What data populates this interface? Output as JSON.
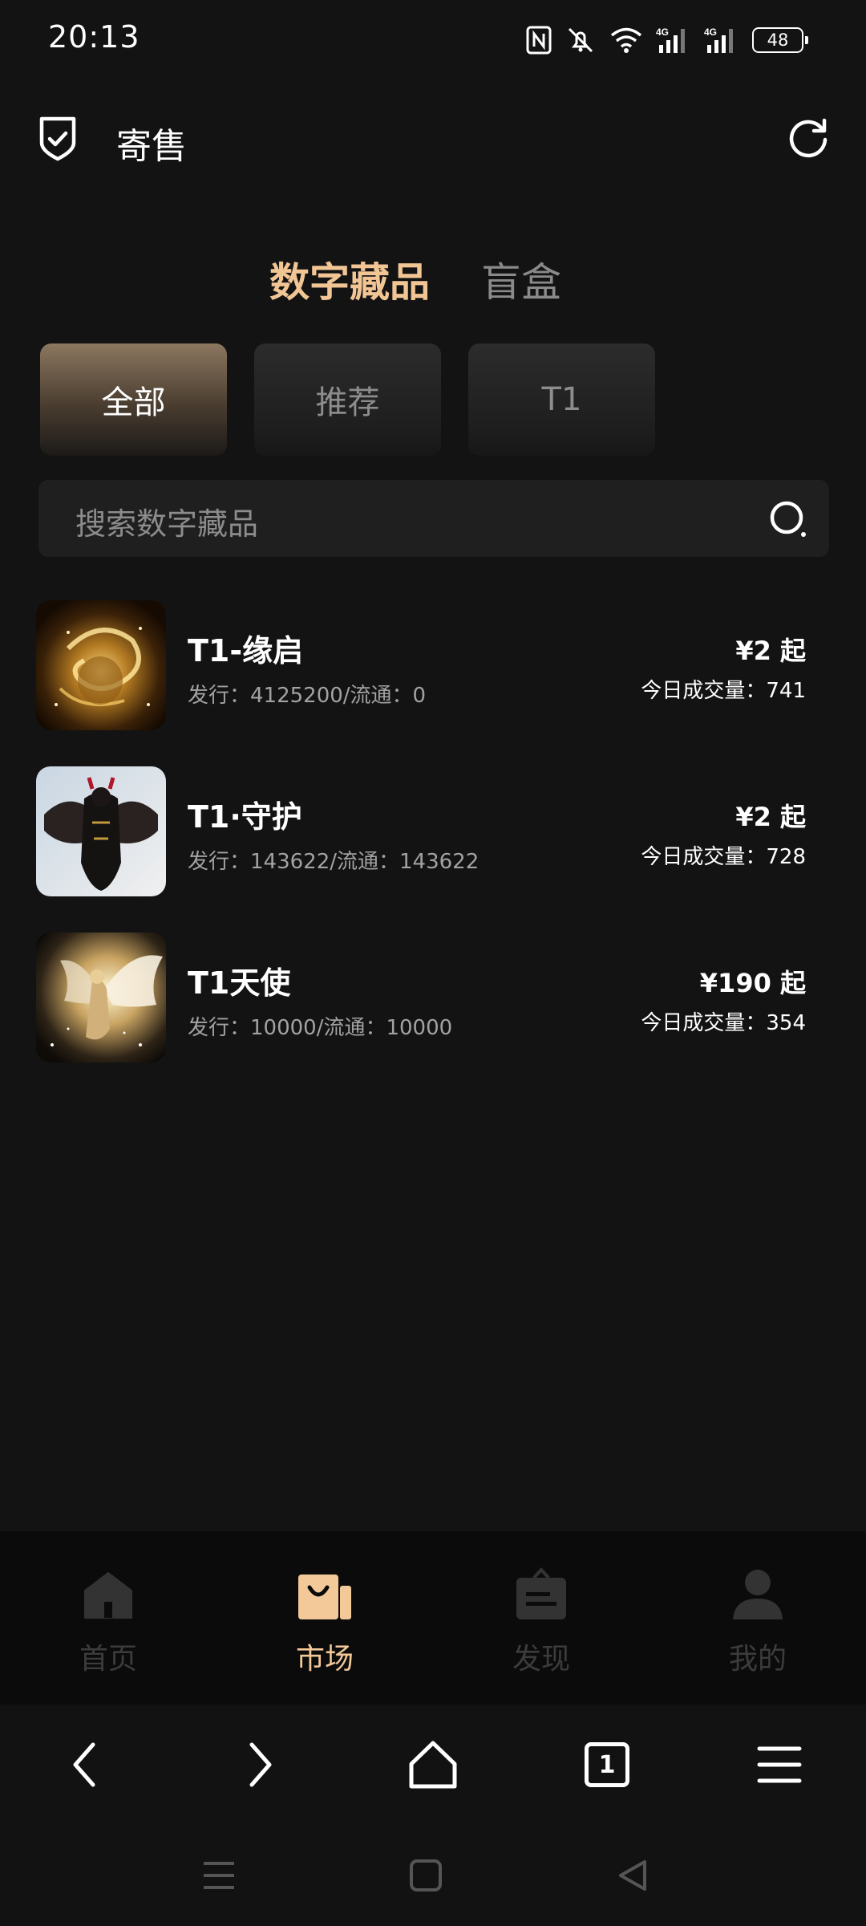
{
  "status_bar": {
    "time": "20:13",
    "battery": "48"
  },
  "header": {
    "title": "寄售"
  },
  "main_tabs": [
    {
      "label": "数字藏品"
    },
    {
      "label": "盲盒"
    }
  ],
  "filters": [
    {
      "label": "全部"
    },
    {
      "label": "推荐"
    },
    {
      "label": "T1"
    }
  ],
  "search": {
    "placeholder": "搜索数字藏品"
  },
  "items": [
    {
      "name": "T1-缘启",
      "meta": "发行：4125200/流通：0",
      "price": "¥2 起",
      "volume": "今日成交量：741"
    },
    {
      "name": "T1·守护",
      "meta": "发行：143622/流通：143622",
      "price": "¥2 起",
      "volume": "今日成交量：728"
    },
    {
      "name": "T1天使",
      "meta": "发行：10000/流通：10000",
      "price": "¥190 起",
      "volume": "今日成交量：354"
    }
  ],
  "bottom_nav": [
    {
      "label": "首页"
    },
    {
      "label": "市场"
    },
    {
      "label": "发现"
    },
    {
      "label": "我的"
    }
  ],
  "browser": {
    "tab_count": "1"
  },
  "colors": {
    "accent": "#f2c595",
    "background": "#131313",
    "nav_background": "#0b0b0b"
  }
}
